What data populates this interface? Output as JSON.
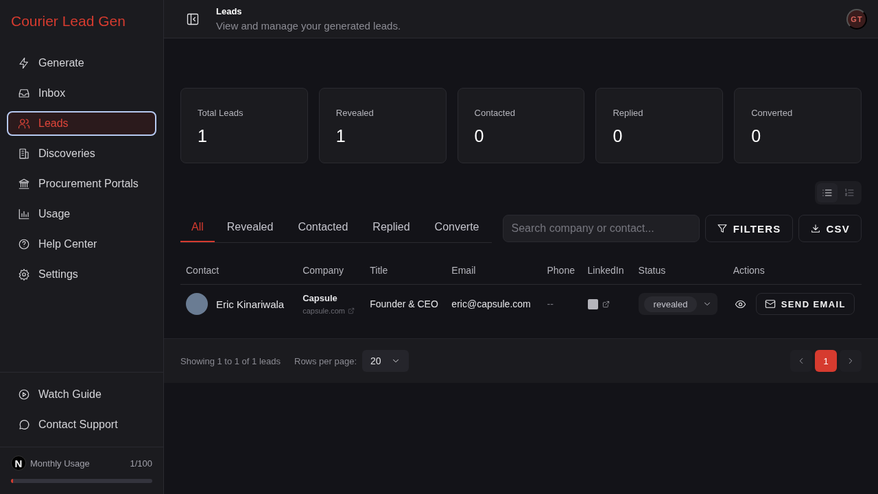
{
  "app": {
    "title": "Courier Lead Gen"
  },
  "sidebar": {
    "items": [
      {
        "label": "Generate",
        "kind": "zap",
        "selected": false
      },
      {
        "label": "Inbox",
        "kind": "inbox",
        "selected": false
      },
      {
        "label": "Leads",
        "kind": "users",
        "selected": true
      },
      {
        "label": "Discoveries",
        "kind": "building",
        "selected": false
      },
      {
        "label": "Procurement Portals",
        "kind": "bank",
        "selected": false
      },
      {
        "label": "Usage",
        "kind": "chart",
        "selected": false
      },
      {
        "label": "Help Center",
        "kind": "help",
        "selected": false
      },
      {
        "label": "Settings",
        "kind": "gear",
        "selected": false
      }
    ],
    "help_items": [
      {
        "label": "Watch Guide",
        "kind": "play"
      },
      {
        "label": "Contact Support",
        "kind": "chat"
      }
    ],
    "usage": {
      "label": "Monthly Usage",
      "count": "1/100",
      "level": 0.01
    }
  },
  "dev_badge": {
    "label": "N"
  },
  "header": {
    "title": "Leads",
    "subtitle": "View and manage your generated leads.",
    "avatar": "GT"
  },
  "stats": [
    {
      "label": "Total Leads",
      "value": "1"
    },
    {
      "label": "Revealed",
      "value": "1"
    },
    {
      "label": "Contacted",
      "value": "0"
    },
    {
      "label": "Replied",
      "value": "0"
    },
    {
      "label": "Converted",
      "value": "0"
    }
  ],
  "view_toggle": [
    {
      "kind": "list",
      "selected": true
    },
    {
      "kind": "numbered",
      "selected": false
    }
  ],
  "tabs": [
    {
      "label": "All",
      "selected": true
    },
    {
      "label": "Revealed",
      "selected": false
    },
    {
      "label": "Contacted",
      "selected": false
    },
    {
      "label": "Replied",
      "selected": false
    },
    {
      "label": "Converte",
      "selected": false
    }
  ],
  "search": {
    "placeholder": "Search company or contact..."
  },
  "buttons": [
    {
      "label": "FILTERS",
      "kind": "filter"
    },
    {
      "label": "CSV",
      "kind": "download"
    }
  ],
  "table": {
    "columns": [
      "Contact",
      "Company",
      "Title",
      "Email",
      "Phone",
      "LinkedIn",
      "Status",
      "Actions"
    ],
    "rows": [
      {
        "contact": "Eric Kinariwala",
        "company": "Capsule",
        "domain": "capsule.com",
        "title": "Founder & CEO",
        "email": "eric@capsule.com",
        "phone": "--",
        "status": "revealed",
        "action": "SEND EMAIL"
      }
    ]
  },
  "footer": {
    "showing": "Showing 1 to 1 of 1 leads",
    "rows_label": "Rows per page:",
    "rows_value": "20",
    "pages": [
      {
        "label": "1",
        "selected": true
      }
    ]
  }
}
